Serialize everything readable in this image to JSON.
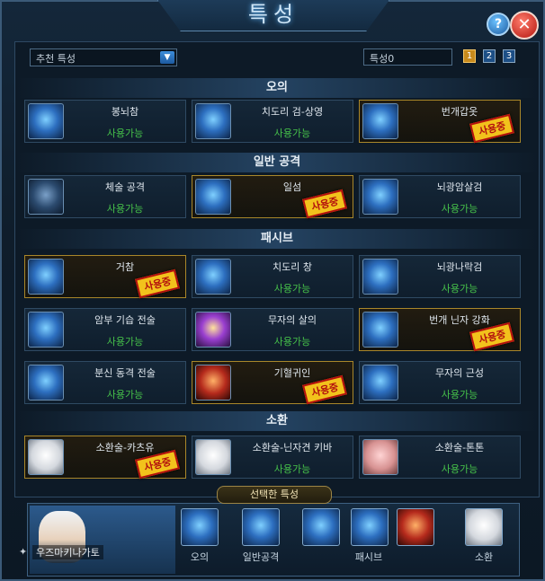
{
  "window": {
    "title": "특성"
  },
  "buttons": {
    "help": "?",
    "close": "✕"
  },
  "toolbar": {
    "dropdown_value": "추천 특성",
    "points_label": "특성0",
    "pages": [
      "1",
      "2",
      "3"
    ]
  },
  "sections": [
    {
      "title": "오의",
      "cards": [
        {
          "name": "봉뇌참",
          "status": "사용가능",
          "in_use": false
        },
        {
          "name": "치도리 검-상영",
          "status": "사용가능",
          "in_use": false
        },
        {
          "name": "번개갑옷",
          "status": "",
          "in_use": true
        }
      ]
    },
    {
      "title": "일반 공격",
      "cards": [
        {
          "name": "체술 공격",
          "status": "사용가능",
          "in_use": false
        },
        {
          "name": "일섬",
          "status": "",
          "in_use": true
        },
        {
          "name": "뇌광암살검",
          "status": "사용가능",
          "in_use": false
        }
      ]
    },
    {
      "title": "패시브",
      "cards": [
        {
          "name": "거참",
          "status": "",
          "in_use": true
        },
        {
          "name": "치도리 창",
          "status": "사용가능",
          "in_use": false
        },
        {
          "name": "뇌광나락검",
          "status": "사용가능",
          "in_use": false
        },
        {
          "name": "암부 기습 전술",
          "status": "사용가능",
          "in_use": false
        },
        {
          "name": "무자의 살의",
          "status": "사용가능",
          "in_use": false
        },
        {
          "name": "번개 닌자 강화",
          "status": "",
          "in_use": true
        },
        {
          "name": "분신 동격 전술",
          "status": "사용가능",
          "in_use": false
        },
        {
          "name": "기혈귀인",
          "status": "",
          "in_use": true
        },
        {
          "name": "무자의 근성",
          "status": "사용가능",
          "in_use": false
        }
      ]
    },
    {
      "title": "소환",
      "cards": [
        {
          "name": "소환술-카츠유",
          "status": "",
          "in_use": true
        },
        {
          "name": "소환술-닌자견 키바",
          "status": "사용가능",
          "in_use": false
        },
        {
          "name": "소환술-톤톤",
          "status": "사용가능",
          "in_use": false
        }
      ]
    }
  ],
  "stamp_text": "사용중",
  "selected": {
    "header": "선택한 특성",
    "character_name": "우즈마키나가토",
    "labels": {
      "ougi": "오의",
      "normal": "일반공격",
      "passive": "패시브",
      "summon": "소환"
    }
  }
}
